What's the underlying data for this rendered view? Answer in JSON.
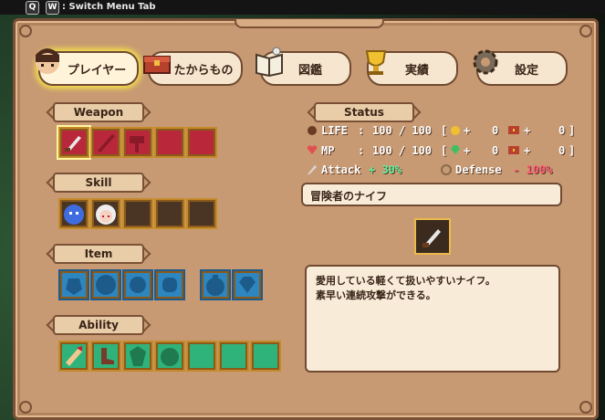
{
  "topbar": {
    "key_q": "Q",
    "key_w": "W",
    "hint": ": Switch Menu Tab"
  },
  "tabs": [
    {
      "label": "プレイヤー",
      "icon": "player-portrait-icon",
      "active": true
    },
    {
      "label": "たからもの",
      "icon": "treasure-chest-icon",
      "active": false
    },
    {
      "label": "図鑑",
      "icon": "encyclopedia-book-icon",
      "active": false
    },
    {
      "label": "実績",
      "icon": "trophy-icon",
      "active": false
    },
    {
      "label": "設定",
      "icon": "gear-icon",
      "active": false
    }
  ],
  "sections": {
    "weapon": "Weapon",
    "skill": "Skill",
    "item": "Item",
    "ability": "Ability",
    "status": "Status"
  },
  "status": {
    "life_label": "LIFE",
    "life_value": "100 / 100",
    "mp_label": "MP",
    "mp_value": "100 / 100",
    "life_bonus_a": "0",
    "life_bonus_b": "0",
    "mp_bonus_a": "0",
    "mp_bonus_b": "0",
    "attack_label": "Attack",
    "attack_value": "+ 30%",
    "defense_label": "Defense",
    "defense_value": "- 100%"
  },
  "selected_item": {
    "name": "冒険者のナイフ",
    "description_line1": "愛用している軽くて扱いやすいナイフ。",
    "description_line2": "素早い連続攻撃ができる。"
  },
  "colors": {
    "panel": "#c89a73",
    "weapon_slot": "#b8283a",
    "skill_slot": "#4a3424",
    "item_slot": "#2e86c0",
    "ability_slot": "#2fb37a",
    "highlight": "#f4e04a"
  }
}
